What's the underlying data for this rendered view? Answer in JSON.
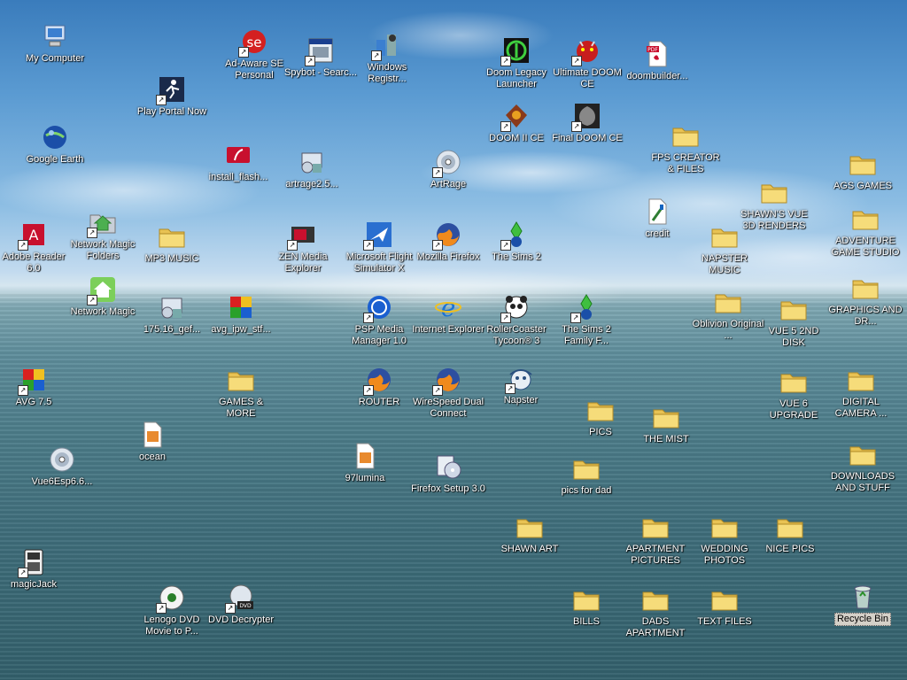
{
  "desktop": {
    "icons": [
      {
        "label": "My Computer",
        "icon": "computer-icon",
        "shortcut": false
      },
      {
        "label": "Ad-Aware SE Personal",
        "icon": "ad-aware-icon",
        "shortcut": true
      },
      {
        "label": "Spybot - Searc...",
        "icon": "spybot-icon",
        "shortcut": true
      },
      {
        "label": "Windows Registr...",
        "icon": "registry-tool-icon",
        "shortcut": true
      },
      {
        "label": "Doom Legacy Launcher",
        "icon": "doom-legacy-icon",
        "shortcut": true
      },
      {
        "label": "Ultimate DOOM CE",
        "icon": "doom-demon-icon",
        "shortcut": true
      },
      {
        "label": "doombuilder...",
        "icon": "pdf-file-icon",
        "shortcut": false
      },
      {
        "label": "Play Portal Now",
        "icon": "play-portal-icon",
        "shortcut": true
      },
      {
        "label": "DOOM II CE",
        "icon": "doom2-icon",
        "shortcut": true
      },
      {
        "label": "Final DOOM CE",
        "icon": "final-doom-icon",
        "shortcut": true
      },
      {
        "label": "FPS CREATOR & FILES",
        "icon": "folder-icon",
        "shortcut": false
      },
      {
        "label": "Google Earth",
        "icon": "globe-icon",
        "shortcut": false
      },
      {
        "label": "install_flash...",
        "icon": "flash-installer-icon",
        "shortcut": false
      },
      {
        "label": "artrage2.5...",
        "icon": "installer-icon",
        "shortcut": false
      },
      {
        "label": "ArtRage",
        "icon": "disc-icon",
        "shortcut": true
      },
      {
        "label": "AGS GAMES",
        "icon": "folder-icon",
        "shortcut": false
      },
      {
        "label": "SHAWN'S VUE 3D RENDERS",
        "icon": "folder-icon",
        "shortcut": false
      },
      {
        "label": "credit",
        "icon": "paint-file-icon",
        "shortcut": false
      },
      {
        "label": "ADVENTURE GAME STUDIO",
        "icon": "folder-icon",
        "shortcut": false
      },
      {
        "label": "Adobe Reader 6.0",
        "icon": "adobe-reader-icon",
        "shortcut": true
      },
      {
        "label": "Network Magic Folders",
        "icon": "network-folder-icon",
        "shortcut": true
      },
      {
        "label": "MP3 MUSIC",
        "icon": "folder-icon",
        "shortcut": false
      },
      {
        "label": "ZEN Media Explorer",
        "icon": "media-player-icon",
        "shortcut": true
      },
      {
        "label": "Microsoft Flight Simulator X",
        "icon": "airplane-icon",
        "shortcut": true
      },
      {
        "label": "Mozilla Firefox",
        "icon": "firefox-icon",
        "shortcut": true
      },
      {
        "label": "The Sims 2",
        "icon": "sims-icon",
        "shortcut": true
      },
      {
        "label": "NAPSTER MUSIC",
        "icon": "folder-icon",
        "shortcut": false
      },
      {
        "label": "GRAPHICS AND DR...",
        "icon": "folder-icon",
        "shortcut": false
      },
      {
        "label": "Network Magic",
        "icon": "house-icon",
        "shortcut": true
      },
      {
        "label": "175.16_gef...",
        "icon": "installer-icon",
        "shortcut": false
      },
      {
        "label": "avg_ipw_stf...",
        "icon": "avg-icon",
        "shortcut": false
      },
      {
        "label": "PSP Media Manager 1.0",
        "icon": "psp-icon",
        "shortcut": true
      },
      {
        "label": "Internet Explorer",
        "icon": "internet-explorer-icon",
        "shortcut": false
      },
      {
        "label": "RollerCoaster Tycoon® 3",
        "icon": "panda-icon",
        "shortcut": true
      },
      {
        "label": "The Sims 2 Family F...",
        "icon": "sims-icon",
        "shortcut": true
      },
      {
        "label": "Oblivion Original ...",
        "icon": "folder-icon",
        "shortcut": false
      },
      {
        "label": "VUE 5 2ND DISK",
        "icon": "folder-icon",
        "shortcut": false
      },
      {
        "label": "AVG 7.5",
        "icon": "avg-icon",
        "shortcut": true
      },
      {
        "label": "GAMES & MORE",
        "icon": "folder-icon",
        "shortcut": false
      },
      {
        "label": "ROUTER",
        "icon": "firefox-icon",
        "shortcut": true
      },
      {
        "label": "WireSpeed Dual Connect",
        "icon": "firefox-icon",
        "shortcut": true
      },
      {
        "label": "Napster",
        "icon": "napster-icon",
        "shortcut": true
      },
      {
        "label": "VUE 6 UPGRADE",
        "icon": "folder-icon",
        "shortcut": false
      },
      {
        "label": "DIGITAL CAMERA ...",
        "icon": "folder-icon",
        "shortcut": false
      },
      {
        "label": "PICS",
        "icon": "folder-icon",
        "shortcut": false
      },
      {
        "label": "THE MIST",
        "icon": "folder-icon",
        "shortcut": false
      },
      {
        "label": "ocean",
        "icon": "image-file-icon",
        "shortcut": false
      },
      {
        "label": "97lumina",
        "icon": "image-file-icon",
        "shortcut": false
      },
      {
        "label": "Vue6Esp6.6...",
        "icon": "disc-icon",
        "shortcut": false
      },
      {
        "label": "Firefox Setup 3.0",
        "icon": "setup-cd-icon",
        "shortcut": false
      },
      {
        "label": "pics for dad",
        "icon": "folder-icon",
        "shortcut": false
      },
      {
        "label": "DOWNLOADS AND STUFF",
        "icon": "folder-icon",
        "shortcut": false
      },
      {
        "label": "SHAWN ART",
        "icon": "folder-icon",
        "shortcut": false
      },
      {
        "label": "APARTMENT PICTURES",
        "icon": "folder-icon",
        "shortcut": false
      },
      {
        "label": "WEDDING PHOTOS",
        "icon": "folder-icon",
        "shortcut": false
      },
      {
        "label": "NICE PICS",
        "icon": "folder-icon",
        "shortcut": false
      },
      {
        "label": "magicJack",
        "icon": "phone-icon",
        "shortcut": true
      },
      {
        "label": "Lenogo DVD Movie to P...",
        "icon": "dvd-converter-icon",
        "shortcut": true
      },
      {
        "label": "DVD Decrypter",
        "icon": "dvd-icon",
        "shortcut": true
      },
      {
        "label": "BILLS",
        "icon": "folder-icon",
        "shortcut": false
      },
      {
        "label": "DADS APARTMENT",
        "icon": "folder-icon",
        "shortcut": false
      },
      {
        "label": "TEXT FILES",
        "icon": "folder-icon",
        "shortcut": false
      },
      {
        "label": "Recycle Bin",
        "icon": "recycle-bin-icon",
        "shortcut": false,
        "selected": true
      }
    ]
  }
}
